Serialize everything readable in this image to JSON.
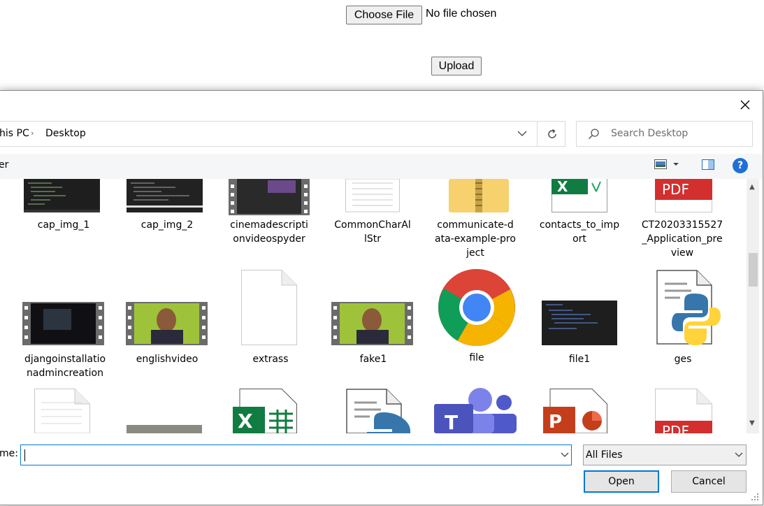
{
  "page": {
    "choose_file_label": "Choose File",
    "no_file_text": "No file chosen",
    "upload_label": "Upload"
  },
  "dialog": {
    "breadcrumb": {
      "part1": "his PC",
      "part2": "Desktop"
    },
    "search_placeholder": "Search Desktop",
    "toolbar_left": "er",
    "files": [
      {
        "name": "cap_img_1",
        "icon": "code-screenshot-thumbnail"
      },
      {
        "name": "cap_img_2",
        "icon": "code-screenshot-thumbnail"
      },
      {
        "name": "cinemadescriptionvideospyder",
        "icon": "video-thumbnail"
      },
      {
        "name": "CommonCharAllStr",
        "icon": "text-file-icon"
      },
      {
        "name": "communicate-data-example-project",
        "icon": "zip-folder-icon"
      },
      {
        "name": "contacts_to_import",
        "icon": "excel-file-icon"
      },
      {
        "name": "CT20203315527_Application_preview",
        "icon": "pdf-file-icon"
      },
      {
        "name": "djangoinstallationadmincreation",
        "icon": "video-thumbnail"
      },
      {
        "name": "englishvideo",
        "icon": "video-thumbnail"
      },
      {
        "name": "extrass",
        "icon": "text-file-icon"
      },
      {
        "name": "fake1",
        "icon": "video-thumbnail"
      },
      {
        "name": "file",
        "icon": "chrome-icon"
      },
      {
        "name": "file1",
        "icon": "code-screenshot-thumbnail"
      },
      {
        "name": "ges",
        "icon": "python-file-icon"
      }
    ],
    "file_name_label": "me:",
    "file_name_value": "",
    "file_type": "All Files",
    "open_label": "Open",
    "cancel_label": "Cancel"
  },
  "colors": {
    "accent": "#0078d7",
    "help": "#1f6fd8",
    "excel": "#107c41",
    "pdf": "#d32f2f"
  }
}
